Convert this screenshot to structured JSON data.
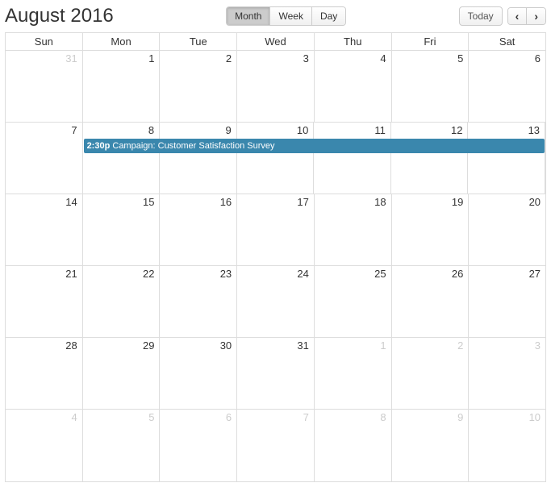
{
  "header": {
    "title": "August 2016",
    "views": {
      "month": "Month",
      "week": "Week",
      "day": "Day"
    },
    "today": "Today",
    "prev": "‹",
    "next": "›"
  },
  "dayNames": [
    "Sun",
    "Mon",
    "Tue",
    "Wed",
    "Thu",
    "Fri",
    "Sat"
  ],
  "weeks": [
    [
      {
        "n": "31",
        "other": true
      },
      {
        "n": "1"
      },
      {
        "n": "2"
      },
      {
        "n": "3"
      },
      {
        "n": "4"
      },
      {
        "n": "5"
      },
      {
        "n": "6"
      }
    ],
    [
      {
        "n": "7"
      },
      {
        "n": "8"
      },
      {
        "n": "9"
      },
      {
        "n": "10"
      },
      {
        "n": "11"
      },
      {
        "n": "12"
      },
      {
        "n": "13"
      }
    ],
    [
      {
        "n": "14"
      },
      {
        "n": "15"
      },
      {
        "n": "16"
      },
      {
        "n": "17"
      },
      {
        "n": "18"
      },
      {
        "n": "19"
      },
      {
        "n": "20"
      }
    ],
    [
      {
        "n": "21"
      },
      {
        "n": "22"
      },
      {
        "n": "23"
      },
      {
        "n": "24"
      },
      {
        "n": "25"
      },
      {
        "n": "26"
      },
      {
        "n": "27"
      }
    ],
    [
      {
        "n": "28"
      },
      {
        "n": "29"
      },
      {
        "n": "30"
      },
      {
        "n": "31"
      },
      {
        "n": "1",
        "other": true
      },
      {
        "n": "2",
        "other": true
      },
      {
        "n": "3",
        "other": true
      }
    ],
    [
      {
        "n": "4",
        "other": true
      },
      {
        "n": "5",
        "other": true
      },
      {
        "n": "6",
        "other": true
      },
      {
        "n": "7",
        "other": true
      },
      {
        "n": "8",
        "other": true
      },
      {
        "n": "9",
        "other": true
      },
      {
        "n": "10",
        "other": true
      }
    ]
  ],
  "event": {
    "weekIndex": 1,
    "startCol": 1,
    "endCol": 6,
    "time": "2:30p",
    "title": "Campaign: Customer Satisfaction Survey",
    "color": "#3a87ad"
  }
}
